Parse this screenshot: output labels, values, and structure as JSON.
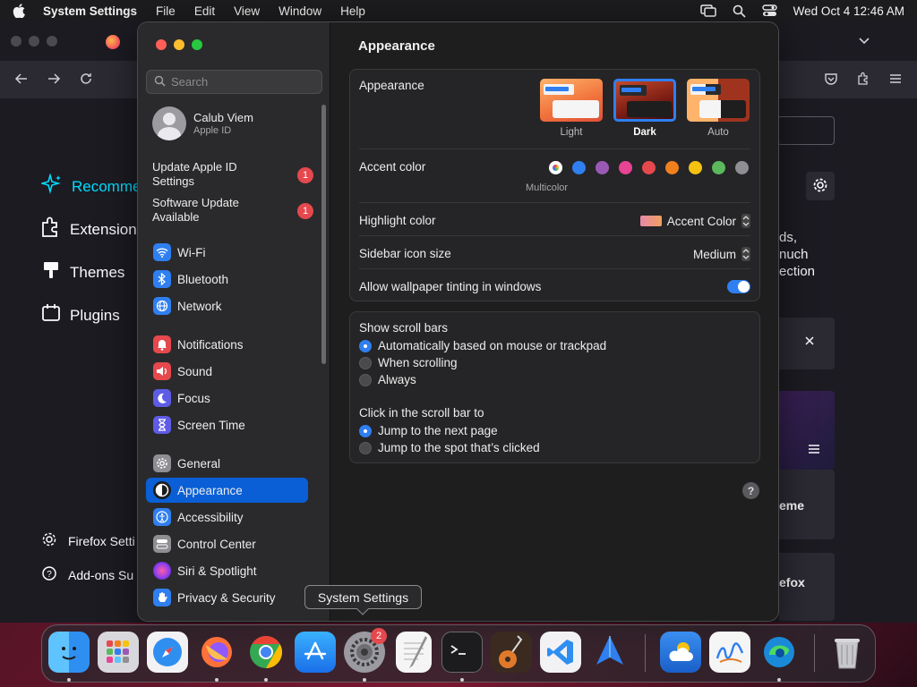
{
  "menubar": {
    "app_name": "System Settings",
    "items": [
      "File",
      "Edit",
      "View",
      "Window",
      "Help"
    ],
    "datetime": "Wed Oct 4  12:46 AM"
  },
  "firefox": {
    "sidebar": [
      {
        "label": "Recommen",
        "icon": "sparkle-icon",
        "active": true
      },
      {
        "label": "Extensions",
        "icon": "puzzle-icon"
      },
      {
        "label": "Themes",
        "icon": "brush-icon"
      },
      {
        "label": "Plugins",
        "icon": "plugin-icon"
      }
    ],
    "footer": [
      {
        "label": "Firefox Setti",
        "icon": "gear-icon"
      },
      {
        "label": "Add-ons Su",
        "icon": "help-icon"
      }
    ],
    "peek_lines": [
      "ds,",
      "nuch",
      "ection"
    ],
    "card_theme": "eme",
    "card_firefox": "efox"
  },
  "settings": {
    "search_placeholder": "Search",
    "account": {
      "name": "Calub Viem",
      "sub": "Apple ID"
    },
    "notices": [
      {
        "label": "Update Apple ID Settings",
        "badge": "1"
      },
      {
        "label": "Software Update Available",
        "badge": "1"
      }
    ],
    "groups": [
      [
        {
          "label": "Wi-Fi",
          "icon": "wifi-icon",
          "color": "#2f7ff0"
        },
        {
          "label": "Bluetooth",
          "icon": "bluetooth-icon",
          "color": "#2f7ff0"
        },
        {
          "label": "Network",
          "icon": "globe-icon",
          "color": "#2f7ff0"
        }
      ],
      [
        {
          "label": "Notifications",
          "icon": "bell-icon",
          "color": "#e5484d"
        },
        {
          "label": "Sound",
          "icon": "speaker-icon",
          "color": "#e5484d"
        },
        {
          "label": "Focus",
          "icon": "moon-icon",
          "color": "#5e5ce6"
        },
        {
          "label": "Screen Time",
          "icon": "hourglass-icon",
          "color": "#5e5ce6"
        }
      ],
      [
        {
          "label": "General",
          "icon": "gear-icon",
          "color": "#8e8e93"
        },
        {
          "label": "Appearance",
          "icon": "appearance-icon",
          "color": "#1c1c1e",
          "selected": true
        },
        {
          "label": "Accessibility",
          "icon": "accessibility-icon",
          "color": "#2f7ff0"
        },
        {
          "label": "Control Center",
          "icon": "control-center-icon",
          "color": "#8e8e93"
        },
        {
          "label": "Siri & Spotlight",
          "icon": "siri-icon",
          "color": "#b04ae0"
        },
        {
          "label": "Privacy & Security",
          "icon": "hand-icon",
          "color": "#2f7ff0"
        }
      ]
    ],
    "page_title": "Appearance",
    "appearance": {
      "label": "Appearance",
      "options": [
        {
          "label": "Light"
        },
        {
          "label": "Dark",
          "selected": true
        },
        {
          "label": "Auto"
        }
      ]
    },
    "accent": {
      "label": "Accent color",
      "selected_label": "Multicolor",
      "colors": [
        "#8e8e93",
        "#2f7ff0",
        "#9b59b6",
        "#e94393",
        "#e5484d",
        "#f0801e",
        "#f5c211",
        "#5cb85c",
        "#8e8e93"
      ]
    },
    "highlight": {
      "label": "Highlight color",
      "value": "Accent Color"
    },
    "icon_size": {
      "label": "Sidebar icon size",
      "value": "Medium"
    },
    "tinting": {
      "label": "Allow wallpaper tinting in windows",
      "on": true
    },
    "scroll_bars": {
      "label": "Show scroll bars",
      "options": [
        {
          "label": "Automatically based on mouse or trackpad",
          "on": true
        },
        {
          "label": "When scrolling"
        },
        {
          "label": "Always"
        }
      ]
    },
    "click_scroll": {
      "label": "Click in the scroll bar to",
      "options": [
        {
          "label": "Jump to the next page",
          "on": true
        },
        {
          "label": "Jump to the spot that’s clicked"
        }
      ]
    },
    "help": "?"
  },
  "tooltip": "System Settings",
  "dock": {
    "badge": "2",
    "apps": [
      "finder-icon",
      "launchpad-icon",
      "safari-icon",
      "firefox-icon",
      "chrome-icon",
      "app-store-icon",
      "system-settings-icon",
      "textedit-icon",
      "terminal-icon",
      "garageband-icon",
      "vscode-icon",
      "altstore-icon",
      "weather-icon",
      "freeform-icon",
      "edge-icon",
      "trash-icon"
    ]
  }
}
